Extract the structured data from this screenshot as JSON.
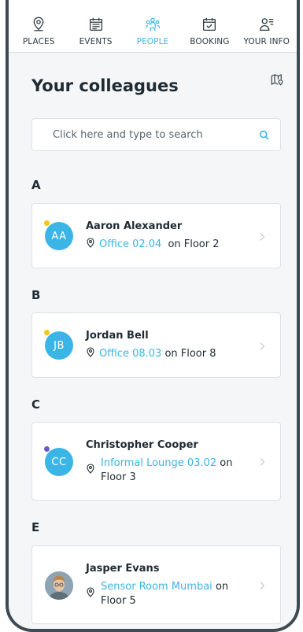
{
  "nav": {
    "items": [
      {
        "label": "PLACES",
        "icon": "location-pin-icon"
      },
      {
        "label": "EVENTS",
        "icon": "calendar-icon"
      },
      {
        "label": "PEOPLE",
        "icon": "people-icon",
        "active": true
      },
      {
        "label": "BOOKING",
        "icon": "calendar-check-icon"
      },
      {
        "label": "YOUR INFO",
        "icon": "user-info-icon"
      }
    ]
  },
  "page": {
    "title": "Your colleagues",
    "map_icon": "map-icon"
  },
  "search": {
    "placeholder": "Click here and type to search",
    "value": ""
  },
  "colors": {
    "accent": "#3ab5e6",
    "text": "#1f2b33",
    "yellow_status": "#f5c518",
    "purple_status": "#6a5acd"
  },
  "groups": [
    {
      "letter": "A",
      "people": [
        {
          "name": "Aaron Alexander",
          "initials": "AA",
          "room": "Office 02.04",
          "floor_text": "on Floor 2",
          "status": "yellow"
        }
      ]
    },
    {
      "letter": "B",
      "people": [
        {
          "name": "Jordan Bell",
          "initials": "JB",
          "room": "Office 08.03",
          "floor_text": "on Floor 8",
          "status": "yellow"
        }
      ]
    },
    {
      "letter": "C",
      "people": [
        {
          "name": "Christopher Cooper",
          "initials": "CC",
          "room": "Informal Lounge 03.02",
          "floor_text": "on",
          "floor_text2": "Floor 3",
          "status": "purple"
        }
      ]
    },
    {
      "letter": "E",
      "people": [
        {
          "name": "Jasper Evans",
          "initials": "",
          "room": "Sensor Room Mumbai",
          "floor_text": "on",
          "floor_text2": "Floor 5",
          "status": "none",
          "photo": true
        }
      ]
    }
  ]
}
